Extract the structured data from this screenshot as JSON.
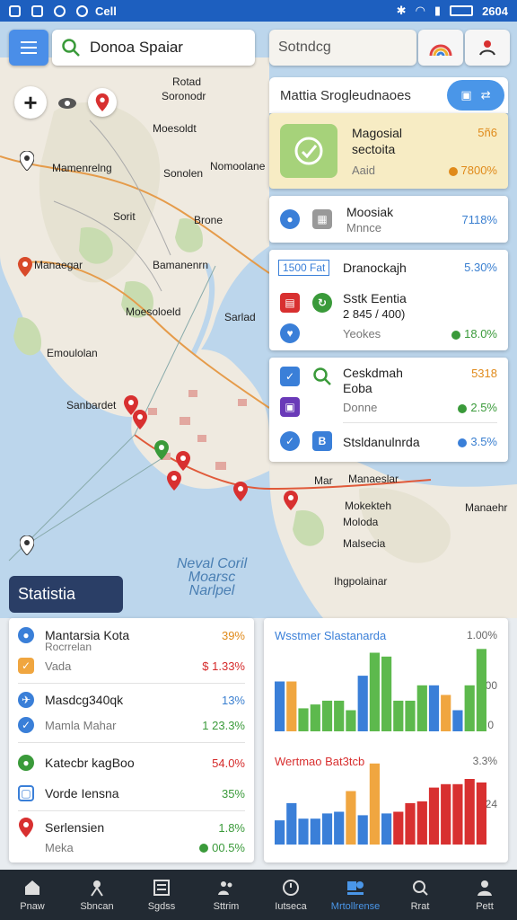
{
  "status_bar": {
    "time_left": "Cell",
    "clock": "2604"
  },
  "search": {
    "query": "Donoa Spaiar",
    "secondary": "Sotndcg"
  },
  "map": {
    "places": [
      {
        "name": "Rotad",
        "cls": "p-rotad"
      },
      {
        "name": "Soronodr",
        "cls": "p-soronodr"
      },
      {
        "name": "Moesoldt",
        "cls": "p-moesoldt"
      },
      {
        "name": "Mamenrelng",
        "cls": "p-mamenrelng"
      },
      {
        "name": "Sonolen",
        "cls": "p-sonolen"
      },
      {
        "name": "Nomoolane",
        "cls": "p-nomoolane"
      },
      {
        "name": "Sorit",
        "cls": "p-sorit"
      },
      {
        "name": "Brone",
        "cls": "p-brone"
      },
      {
        "name": "Manaegar",
        "cls": "p-manaegar"
      },
      {
        "name": "Bamanenrn",
        "cls": "p-bamanenrn"
      },
      {
        "name": "Sarlad",
        "cls": "p-sarlad"
      },
      {
        "name": "Emoulolan",
        "cls": "p-emoulolan"
      },
      {
        "name": "Sanbardet",
        "cls": "p-sanbardet"
      },
      {
        "name": "Manaeslar",
        "cls": "p-manaeslar"
      },
      {
        "name": "Mokekteh",
        "cls": "p-mokekteh"
      },
      {
        "name": "Moloda",
        "cls": "p-moloda"
      },
      {
        "name": "Malsecia",
        "cls": "p-malsecia"
      },
      {
        "name": "Manaehr",
        "cls": "p-manaehr"
      },
      {
        "name": "Ihgpolainar",
        "cls": "p-ihgpolainar"
      },
      {
        "name": "Mar",
        "cls": "p-mar"
      },
      {
        "name": "Moesoloeld",
        "cls": "p-moesoloeld"
      }
    ],
    "sea_label": "Neval Coril Moarsc Narlpel"
  },
  "panel": {
    "title": "Mattia Srogleudnaoes",
    "featured": {
      "name": "Magosial",
      "sub": "sectoita",
      "extra": "Aaid",
      "value": "5ñ6",
      "value2": "7800%"
    },
    "card2": {
      "name": "Moosiak",
      "sub": "Mnnce",
      "value": "7118%"
    },
    "card3": {
      "tag": "1500 Fat",
      "row1": {
        "name": "Dranockajh",
        "value": "5.30%"
      },
      "row2": {
        "name": "Sstk Eentia",
        "sub": "2 845 / 400)",
        "extra": "Yeokes",
        "value": "18.0%"
      }
    },
    "card4": {
      "row1": {
        "name": "Ceskdmah",
        "sub": "Eoba",
        "value": "5318"
      },
      "row2": {
        "name": "Donne",
        "value": "2.5%"
      },
      "row3": {
        "name": "Stsldanulnrda",
        "value": "3.5%"
      }
    }
  },
  "stats": {
    "label": "Statistia",
    "items": [
      {
        "name": "Mantarsia Kota",
        "sub": "Rocrrelan",
        "value": "39%"
      },
      {
        "name": "Vada",
        "value": "1.33%"
      },
      {
        "name": "Masdcg340qk",
        "value": "13%"
      },
      {
        "name": "Mamla Mahar",
        "value": "23.3%"
      },
      {
        "name": "Katecbr kagBoo",
        "value": "54.0%"
      },
      {
        "name": "Vorde Iensna",
        "value": "35%"
      },
      {
        "name": "Serlensien",
        "value": "1.8%"
      },
      {
        "name": "Meka",
        "value": "00.5%"
      }
    ]
  },
  "chart_data": [
    {
      "type": "bar",
      "title": "Wsstmer Slastanarda",
      "header_value": "1.00%",
      "tick_labels": [
        "00",
        "0"
      ],
      "series": [
        {
          "color": "#3a7fd8",
          "values": [
            52,
            30
          ]
        },
        {
          "color": "#f0a640",
          "values": [
            52,
            24
          ]
        },
        {
          "color": "#5db94d",
          "values": [
            28,
            32,
            32,
            22,
            58,
            82,
            78,
            32,
            32,
            48,
            48,
            38,
            22,
            48,
            86
          ]
        }
      ],
      "values": [
        52,
        52,
        24,
        28,
        32,
        32,
        22,
        58,
        82,
        78,
        32,
        32,
        48,
        48,
        38,
        22,
        48,
        86
      ]
    },
    {
      "type": "bar",
      "title": "Wertmao Bat3tcb",
      "header_value": "3.3%",
      "tick_labels": [
        "24"
      ],
      "values": [
        28,
        48,
        30,
        30,
        36,
        38,
        62,
        34,
        94,
        36,
        38,
        48,
        50,
        66,
        70,
        70,
        76,
        72
      ]
    }
  ],
  "nav": [
    "Pnaw",
    "Sbncan",
    "Sgdss",
    "Sttrim",
    "Iutseca",
    "Mrtollrense",
    "Rrat",
    "Pett"
  ]
}
